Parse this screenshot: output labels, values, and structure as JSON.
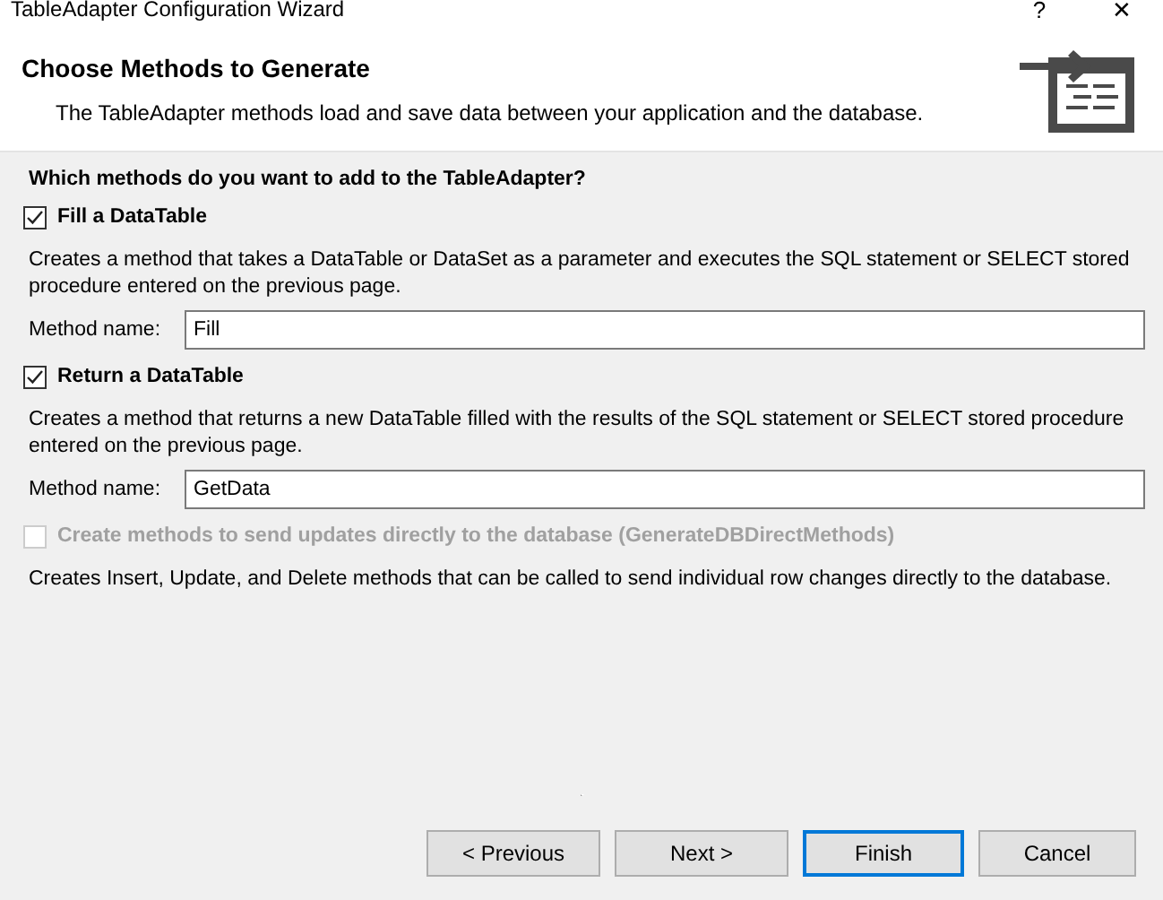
{
  "window": {
    "title": "TableAdapter Configuration Wizard",
    "help": "?",
    "close": "✕"
  },
  "header": {
    "title": "Choose Methods to Generate",
    "subtitle": "The TableAdapter methods load and save data between your application and the database."
  },
  "question": "Which methods do you want to add to the TableAdapter?",
  "options": [
    {
      "kind": "method",
      "label": "Fill a DataTable",
      "checked": true,
      "disabled": false,
      "description": "Creates a method that takes a DataTable or DataSet as a parameter and executes the SQL statement or SELECT stored procedure entered on the previous page.",
      "method_name": {
        "label": "Method name:",
        "value": "Fill"
      }
    },
    {
      "kind": "method",
      "label": "Return a DataTable",
      "checked": true,
      "disabled": false,
      "description": "Creates a method that returns a new DataTable filled with the results of the SQL statement or SELECT stored procedure entered on the previous page.",
      "method_name": {
        "label": "Method name:",
        "value": "GetData"
      }
    },
    {
      "kind": "option",
      "label": "Create methods to send updates directly to the database (GenerateDBDirectMethods)",
      "checked": false,
      "disabled": true,
      "description": "Creates Insert, Update, and Delete methods that can be called to send individual row changes directly to the database."
    }
  ],
  "buttons": [
    {
      "label": "< Previous",
      "default": false
    },
    {
      "label": "Next >",
      "default": false
    },
    {
      "label": "Finish",
      "default": true
    },
    {
      "label": "Cancel",
      "default": false
    }
  ]
}
